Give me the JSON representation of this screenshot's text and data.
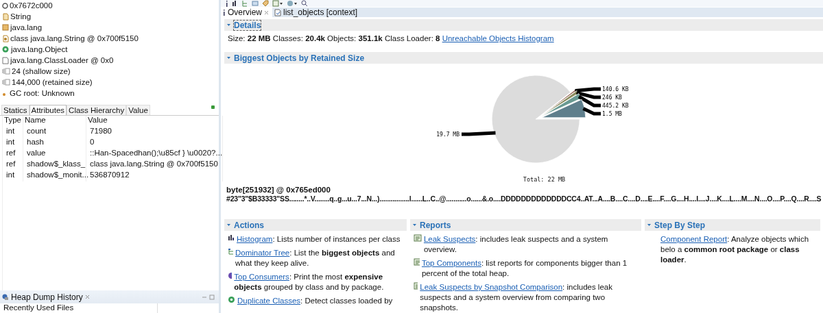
{
  "object_info": [
    {
      "kind": "address",
      "text": "0x7672c000"
    },
    {
      "kind": "class",
      "text": "String"
    },
    {
      "kind": "package",
      "text": "java.lang"
    },
    {
      "kind": "class_object",
      "text": "class java.lang.String @ 0x700f5150"
    },
    {
      "kind": "superclass",
      "text": "java.lang.Object"
    },
    {
      "kind": "loader",
      "text": "java.lang.ClassLoader @ 0x0"
    },
    {
      "kind": "size",
      "text": "24 (shallow size)"
    },
    {
      "kind": "size",
      "text": "144,000 (retained size)"
    },
    {
      "kind": "gc",
      "text": "GC root: Unknown"
    }
  ],
  "inspector_tabs": [
    {
      "label": "Statics",
      "selected": false
    },
    {
      "label": "Attributes",
      "selected": true
    },
    {
      "label": "Class Hierarchy",
      "selected": false
    },
    {
      "label": "Value",
      "selected": false
    }
  ],
  "attributes": {
    "columns": [
      "Type",
      "Name",
      "Value"
    ],
    "rows": [
      [
        "int",
        "count",
        "71980"
      ],
      [
        "int",
        "hash",
        "0"
      ],
      [
        "ref",
        "value",
        "::Han-Spacedhan();\\u85cf } \\u0020?..."
      ],
      [
        "ref",
        "shadow$_klass_",
        "class java.lang.String @ 0x700f5150"
      ],
      [
        "int",
        "shadow$_monit...",
        "536870912"
      ]
    ]
  },
  "history": {
    "title": "Heap Dump History",
    "column": "Recently Used Files"
  },
  "editor_tabs": [
    {
      "kind": "info",
      "label": "Overview",
      "selected": true
    },
    {
      "kind": "query",
      "label": "list_objects  [context]",
      "selected": false
    }
  ],
  "details": {
    "title": "Details",
    "expanded": true,
    "text": "Size: **22 MB** Classes: **20.4k** Objects: **351.1k** Class Loader: **8**",
    "link": "Unreachable Objects Histogram"
  },
  "biggest": {
    "title": "Biggest Objects by Retained Size",
    "expanded": true,
    "total": "Total: 22 MB",
    "chart_data": {
      "type": "pie",
      "values": [
        0.62,
        1.09,
        1.97,
        6.81,
        89.51
      ],
      "colors": [
        "#9a6e5e",
        "#8a8a5c",
        "#6a9a92",
        "#5f7f8c",
        "#dcdcdc"
      ]
    },
    "slice_labels": [
      "140.6 KB",
      "246 KB",
      "445.2 KB",
      "1.5 MB",
      "19.7 MB"
    ]
  },
  "object": {
    "title": "byte[251932] @ 0x765ed000",
    "text": "#23\"3\"$B33333\"SS........*..V........q..g...u...7...N...)................l......L..C..@...........o......&.o....DDDDDDDDDDDDDCC4..AT...A....B....C....D....E....F....G....H....I....J....K....L....M....N....O....P....Q....R....S"
  },
  "panels": [
    {
      "title": "Actions",
      "expanded": true,
      "items": [
        {
          "kind": "histogram",
          "link": "Histogram",
          "text": ": Lists number of instances per class"
        },
        {
          "kind": "tree",
          "link": "Dominator Tree",
          "text": ": List the **biggest objects** and what they keep alive."
        },
        {
          "kind": "consumers",
          "link": "Top Consumers",
          "text": ": Print the most **expensive objects** grouped by class and by package."
        },
        {
          "kind": "duplicates",
          "link": "Duplicate Classes",
          "text": ": Detect classes loaded by"
        }
      ]
    },
    {
      "title": "Reports",
      "expanded": true,
      "items": [
        {
          "kind": "report",
          "link": "Leak Suspects",
          "text": ": includes leak suspects and a system overview."
        },
        {
          "kind": "report",
          "link": "Top Components",
          "text": ": list reports for components bigger than 1 percent of the total heap."
        },
        {
          "kind": "report",
          "link": "Leak Suspects by Snapshot Comparison",
          "text": ": includes leak suspects and a system overview from comparing two snapshots."
        }
      ]
    },
    {
      "title": "Step By Step",
      "expanded": true,
      "items": [
        {
          "kind": "none",
          "link": "Component Report",
          "text": ": Analyze objects which belo a **common root package** or **class loader**."
        }
      ]
    }
  ]
}
